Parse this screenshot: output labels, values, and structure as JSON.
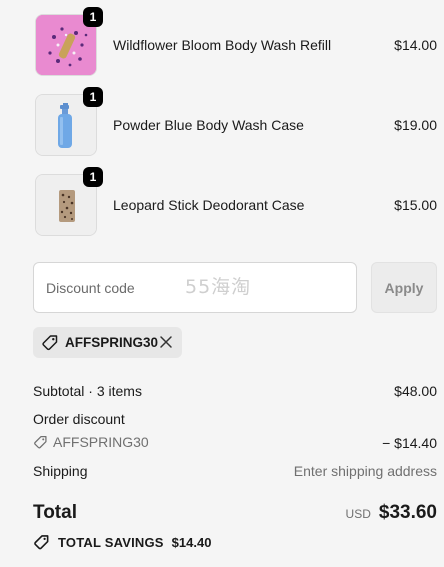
{
  "items": [
    {
      "name": "Wildflower Bloom Body Wash Refill",
      "price": "$14.00",
      "qty": "1",
      "image_icon": "floral-pouch-icon"
    },
    {
      "name": "Powder Blue Body Wash Case",
      "price": "$19.00",
      "qty": "1",
      "image_icon": "pump-bottle-icon"
    },
    {
      "name": "Leopard Stick Deodorant Case",
      "price": "$15.00",
      "qty": "1",
      "image_icon": "leopard-case-icon"
    }
  ],
  "discount": {
    "placeholder": "Discount code",
    "apply_label": "Apply",
    "watermark": "55海淘",
    "applied_code": "AFFSPRING30"
  },
  "summary": {
    "subtotal_label": "Subtotal · 3 items",
    "subtotal_value": "$48.00",
    "order_discount_label": "Order discount",
    "order_discount_code": "AFFSPRING30",
    "order_discount_value": "− $14.40",
    "shipping_label": "Shipping",
    "shipping_value": "Enter shipping address",
    "total_label": "Total",
    "currency": "USD",
    "total_value": "$33.60",
    "savings_label": "TOTAL SAVINGS",
    "savings_value": "$14.40"
  },
  "colors": {
    "background": "#f5f5f5",
    "badge": "#000000",
    "pink_thumb": "#e96fc0",
    "blue_bottle": "#6fa8e6"
  }
}
